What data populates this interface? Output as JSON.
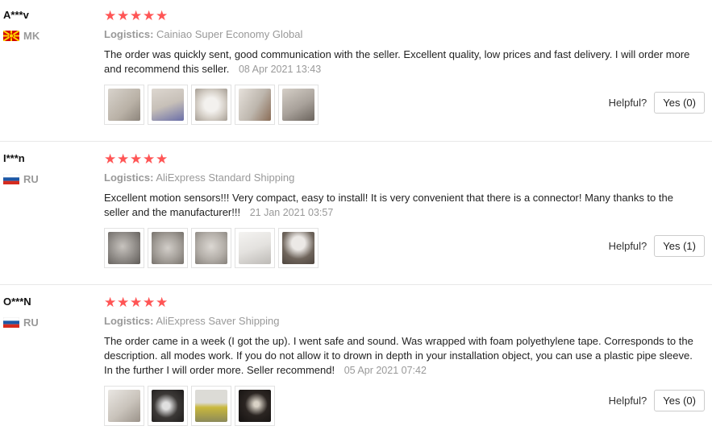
{
  "reviews": [
    {
      "user": "A***v",
      "country": "MK",
      "flag_colors": {
        "bg": "#d20000",
        "fg": "#ffd400"
      },
      "stars": 5,
      "logistics_label": "Logistics:",
      "logistics": "Cainiao Super Economy Global",
      "text": "The order was quickly sent, good communication with the seller. Excellent quality, low prices and fast delivery. I will order more and recommend this seller.",
      "date": "08 Apr 2021 13:43",
      "photos": [
        {
          "name": "photo",
          "color": "#b9b1a6"
        },
        {
          "name": "photo",
          "color": "#c7c0b8"
        },
        {
          "name": "photo",
          "color": "#d6d0c8"
        },
        {
          "name": "photo",
          "color": "#bdb6ad"
        },
        {
          "name": "photo",
          "color": "#a8a19a"
        }
      ],
      "helpful_label": "Helpful?",
      "yes_label": "Yes (0)"
    },
    {
      "user": "I***n",
      "country": "RU",
      "flag_colors": {
        "top": "#ffffff",
        "mid": "#1c57a5",
        "bot": "#d52b1e"
      },
      "stars": 5,
      "logistics_label": "Logistics:",
      "logistics": "AliExpress Standard Shipping",
      "text": "Excellent motion sensors!!! Very compact, easy to install! It is very convenient that there is a connector! Many thanks to the seller and the manufacturer!!!",
      "date": "21 Jan 2021 03:57",
      "photos": [
        {
          "name": "photo",
          "color": "#8e8a86"
        },
        {
          "name": "photo",
          "color": "#a49f99"
        },
        {
          "name": "photo",
          "color": "#b4afa9"
        },
        {
          "name": "photo",
          "color": "#e4e2df"
        },
        {
          "name": "photo",
          "color": "#6f655c"
        }
      ],
      "helpful_label": "Helpful?",
      "yes_label": "Yes (1)"
    },
    {
      "user": "O***N",
      "country": "RU",
      "flag_colors": {
        "top": "#ffffff",
        "mid": "#1c57a5",
        "bot": "#d52b1e"
      },
      "stars": 5,
      "logistics_label": "Logistics:",
      "logistics": "AliExpress Saver Shipping",
      "text": "The order came in a week (I got the up). I went safe and sound. Was wrapped with foam polyethylene tape. Corresponds to the description. all modes work. If you do not allow it to drown in depth in your installation object, you can use a plastic pipe sleeve. In the further I will order more. Seller recommend!",
      "date": "05 Apr 2021 07:42",
      "photos": [
        {
          "name": "photo",
          "color": "#c9c3bb"
        },
        {
          "name": "photo",
          "color": "#3b3836"
        },
        {
          "name": "photo",
          "color": "#8c8a5a"
        },
        {
          "name": "photo",
          "color": "#2b2522"
        }
      ],
      "helpful_label": "Helpful?",
      "yes_label": "Yes (0)"
    }
  ]
}
